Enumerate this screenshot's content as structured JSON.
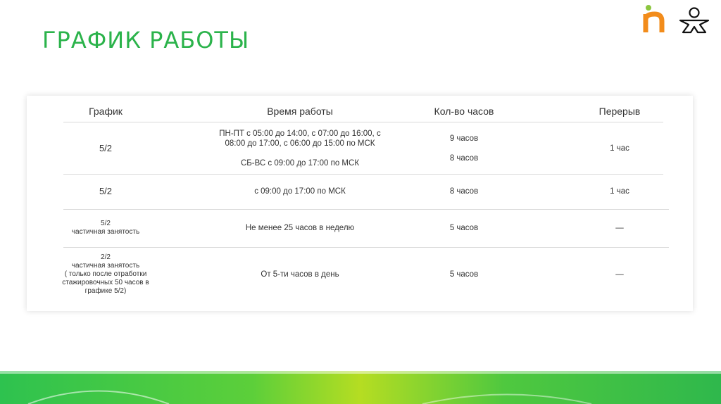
{
  "page": {
    "title": "ГРАФИК РАБОТЫ",
    "colors": {
      "accent_green": "#2bb34b",
      "logo_orange": "#f28c1b",
      "logo_green": "#8cc63f"
    }
  },
  "logos": [
    {
      "name": "brand-n-logo"
    },
    {
      "name": "person-logo"
    }
  ],
  "table": {
    "headers": [
      "График",
      "Время работы",
      "Кол-во часов",
      "Перерыв"
    ],
    "rows": [
      {
        "schedule": [
          "5/2"
        ],
        "time": [
          "ПН-ПТ с 05:00 до 14:00, с 07:00 до 16:00, с 08:00 до 17:00, с 06:00 до 15:00 по МСК",
          "СБ-ВС с 09:00 до 17:00 по МСК"
        ],
        "hours": [
          "9 часов",
          "8 часов"
        ],
        "break": "1 час"
      },
      {
        "schedule": [
          "5/2"
        ],
        "time": [
          "с 09:00 до 17:00 по МСК"
        ],
        "hours": [
          "8 часов"
        ],
        "break": "1 час"
      },
      {
        "schedule": [
          "5/2",
          "частичная занятость"
        ],
        "time": [
          "Не менее 25 часов в неделю"
        ],
        "hours": [
          "5 часов"
        ],
        "break": "—"
      },
      {
        "schedule": [
          "2/2",
          "частичная занятость",
          "( только после отработки стажировочных 50 часов в графике 5/2)"
        ],
        "time": [
          "От 5-ти часов в день"
        ],
        "hours": [
          "5 часов"
        ],
        "break": "—"
      }
    ]
  }
}
